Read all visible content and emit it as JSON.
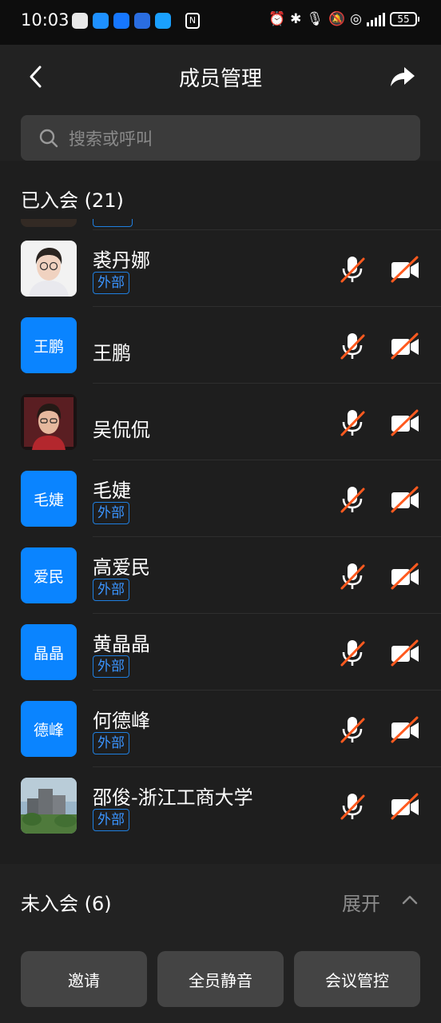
{
  "status_bar": {
    "time": "10:03",
    "battery": "55",
    "app_icons": [
      {
        "name": "photos-app-icon",
        "color": "#e8e8e8"
      },
      {
        "name": "messages-app-icon",
        "color": "#1e90ff"
      },
      {
        "name": "maps-app-icon",
        "color": "#1677ff"
      },
      {
        "name": "ticket-app-icon",
        "color": "#2a6de0"
      },
      {
        "name": "meeting-app-icon",
        "color": "#1aa0ff"
      }
    ]
  },
  "header": {
    "title": "成员管理"
  },
  "search": {
    "placeholder": "搜索或呼叫"
  },
  "joined": {
    "label": "已入会 (21)",
    "members": [
      {
        "name": "裘丹娜",
        "tag": "外部",
        "avatar_text": "",
        "avatar_type": "photo-portrait"
      },
      {
        "name": "王鹏",
        "tag": "",
        "avatar_text": "王鹏",
        "avatar_type": "text"
      },
      {
        "name": "吴侃侃",
        "tag": "",
        "avatar_text": "",
        "avatar_type": "photo-selfie"
      },
      {
        "name": "毛婕",
        "tag": "外部",
        "avatar_text": "毛婕",
        "avatar_type": "text"
      },
      {
        "name": "高爱民",
        "tag": "外部",
        "avatar_text": "爱民",
        "avatar_type": "text"
      },
      {
        "name": "黄晶晶",
        "tag": "外部",
        "avatar_text": "晶晶",
        "avatar_type": "text"
      },
      {
        "name": "何德峰",
        "tag": "外部",
        "avatar_text": "德峰",
        "avatar_type": "text"
      },
      {
        "name": "邵俊-浙江工商大学",
        "tag": "外部",
        "avatar_text": "",
        "avatar_type": "photo-campus"
      }
    ],
    "mic_state": "muted",
    "camera_state": "off"
  },
  "not_joined": {
    "label": "未入会 (6)",
    "expand": "展开"
  },
  "actions": {
    "invite": "邀请",
    "mute_all": "全员静音",
    "meeting_control": "会议管控"
  },
  "colors": {
    "accent": "#0a84ff",
    "muted_slash": "#ff5a1f",
    "background": "#1e1e1e"
  }
}
